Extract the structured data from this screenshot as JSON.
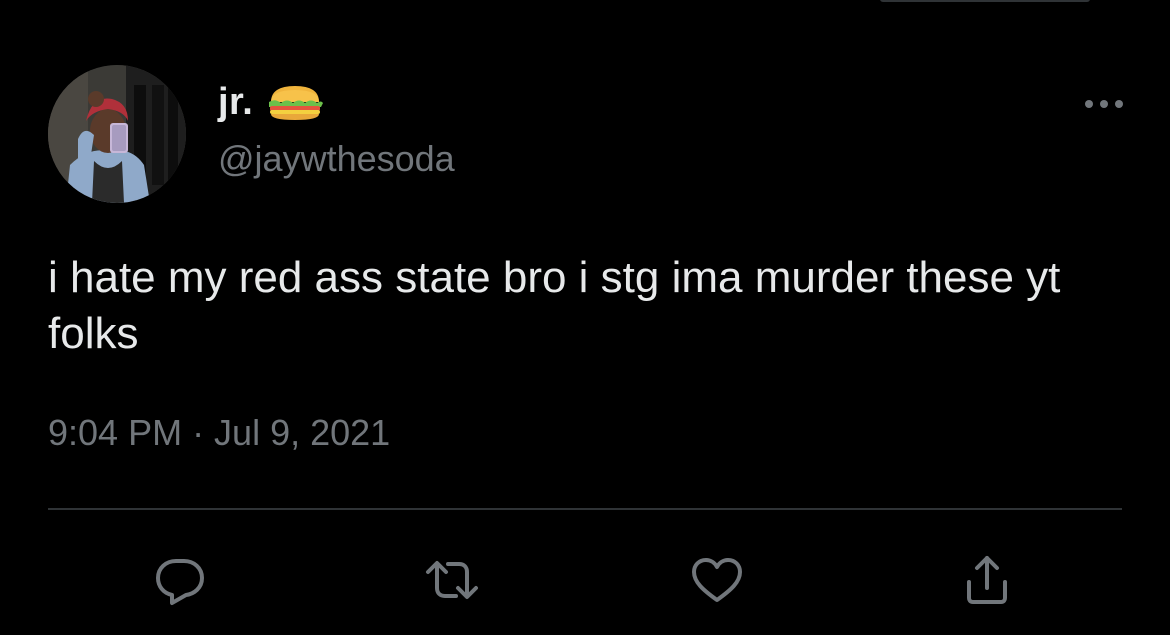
{
  "tweet": {
    "author": {
      "display_name": "jr.",
      "emoji": "sandwich-emoji",
      "handle": "@jaywthesoda"
    },
    "text": "i hate my red ass state bro i stg ima murder these yt folks",
    "timestamp": "9:04 PM · Jul 9, 2021"
  },
  "actions": [
    {
      "icon": "reply-icon"
    },
    {
      "icon": "retweet-icon"
    },
    {
      "icon": "like-icon"
    },
    {
      "icon": "share-icon"
    }
  ],
  "colors": {
    "background": "#000000",
    "primary_text": "#e7e9ea",
    "secondary_text": "#71767b",
    "divider": "#2f3336"
  }
}
